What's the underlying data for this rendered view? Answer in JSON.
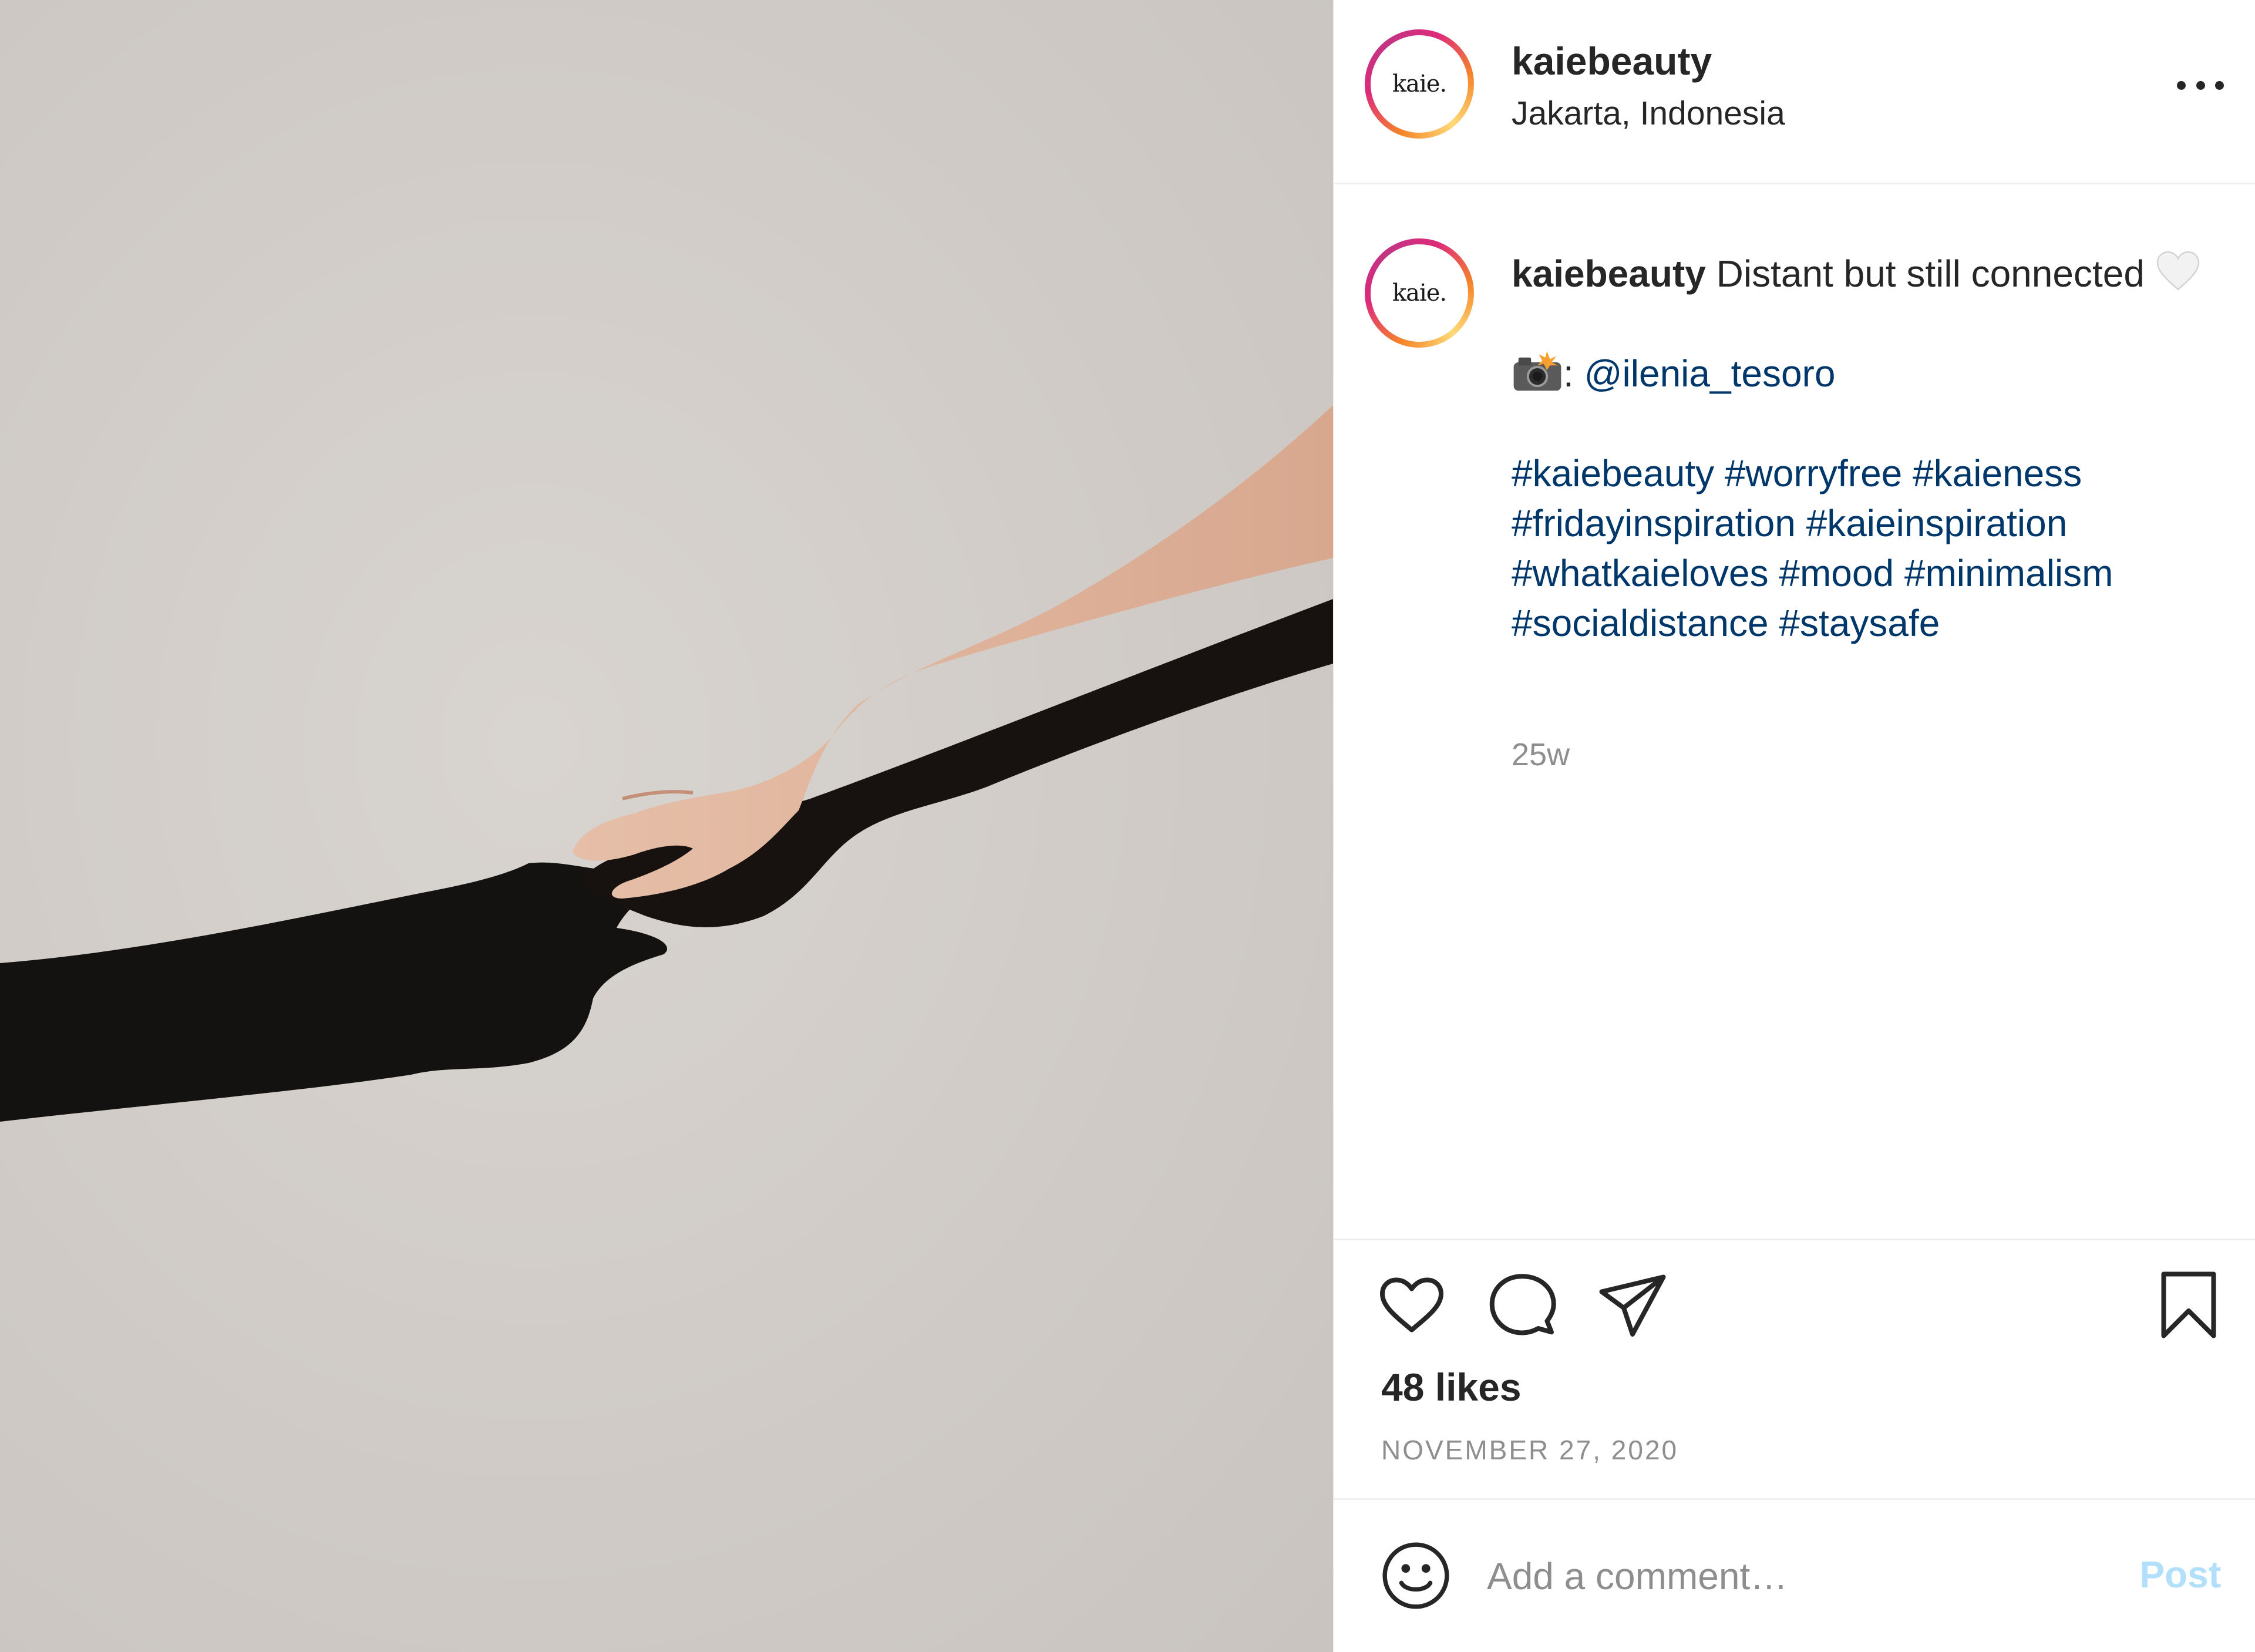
{
  "post": {
    "username": "kaiebeauty",
    "location": "Jakarta, Indonesia",
    "avatar_logo_text": "kaie.",
    "caption": {
      "username": "kaiebeauty",
      "text": "Distant but still connected",
      "credit_separator": ":",
      "credit_handle": "@ilenia_tesoro",
      "hashtags_line1": "#kaiebeauty #worryfree #kaieness",
      "hashtags_line2": "#fridayinspiration #kaieinspiration",
      "hashtags_line3": "#whatkaieloves #mood #minimalism",
      "hashtags_line4": "#socialdistance #staysafe"
    },
    "time_ago": "25w",
    "likes": "48 likes",
    "date": "NOVEMBER 27, 2020"
  },
  "comment": {
    "placeholder": "Add a comment…",
    "post_label": "Post"
  },
  "colors": {
    "link": "#00376b",
    "muted": "#8e8e8e",
    "post_disabled": "#b2dffc"
  },
  "icons": [
    "more-icon",
    "heart-icon",
    "comment-icon",
    "share-icon",
    "bookmark-icon",
    "emoji-icon",
    "white-heart-emoji",
    "camera-flash-emoji"
  ]
}
